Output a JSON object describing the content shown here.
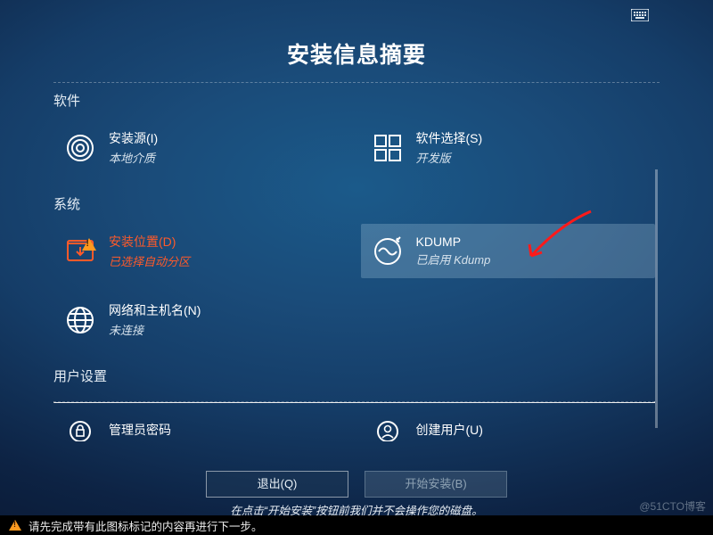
{
  "title": "安装信息摘要",
  "sections": {
    "software": {
      "label": "软件"
    },
    "system": {
      "label": "系统"
    },
    "user": {
      "label": "用户设置"
    }
  },
  "tiles": {
    "source": {
      "heading": "安装源(I)",
      "sub": "本地介质"
    },
    "swsel": {
      "heading": "软件选择(S)",
      "sub": "开发版"
    },
    "dest": {
      "heading": "安装位置(D)",
      "sub": "已选择自动分区"
    },
    "kdump": {
      "heading": "KDUMP",
      "sub": "已启用 Kdump"
    },
    "net": {
      "heading": "网络和主机名(N)",
      "sub": "未连接"
    },
    "rootpw": {
      "heading": "管理员密码",
      "sub": ""
    },
    "user": {
      "heading": "创建用户(U)",
      "sub": ""
    }
  },
  "buttons": {
    "quit": "退出(Q)",
    "begin": "开始安装(B)"
  },
  "hint": "在点击“开始安装”按钮前我们并不会操作您的磁盘。",
  "warnbar": "请先完成带有此图标标记的内容再进行下一步。",
  "watermark": "@51CTO博客"
}
